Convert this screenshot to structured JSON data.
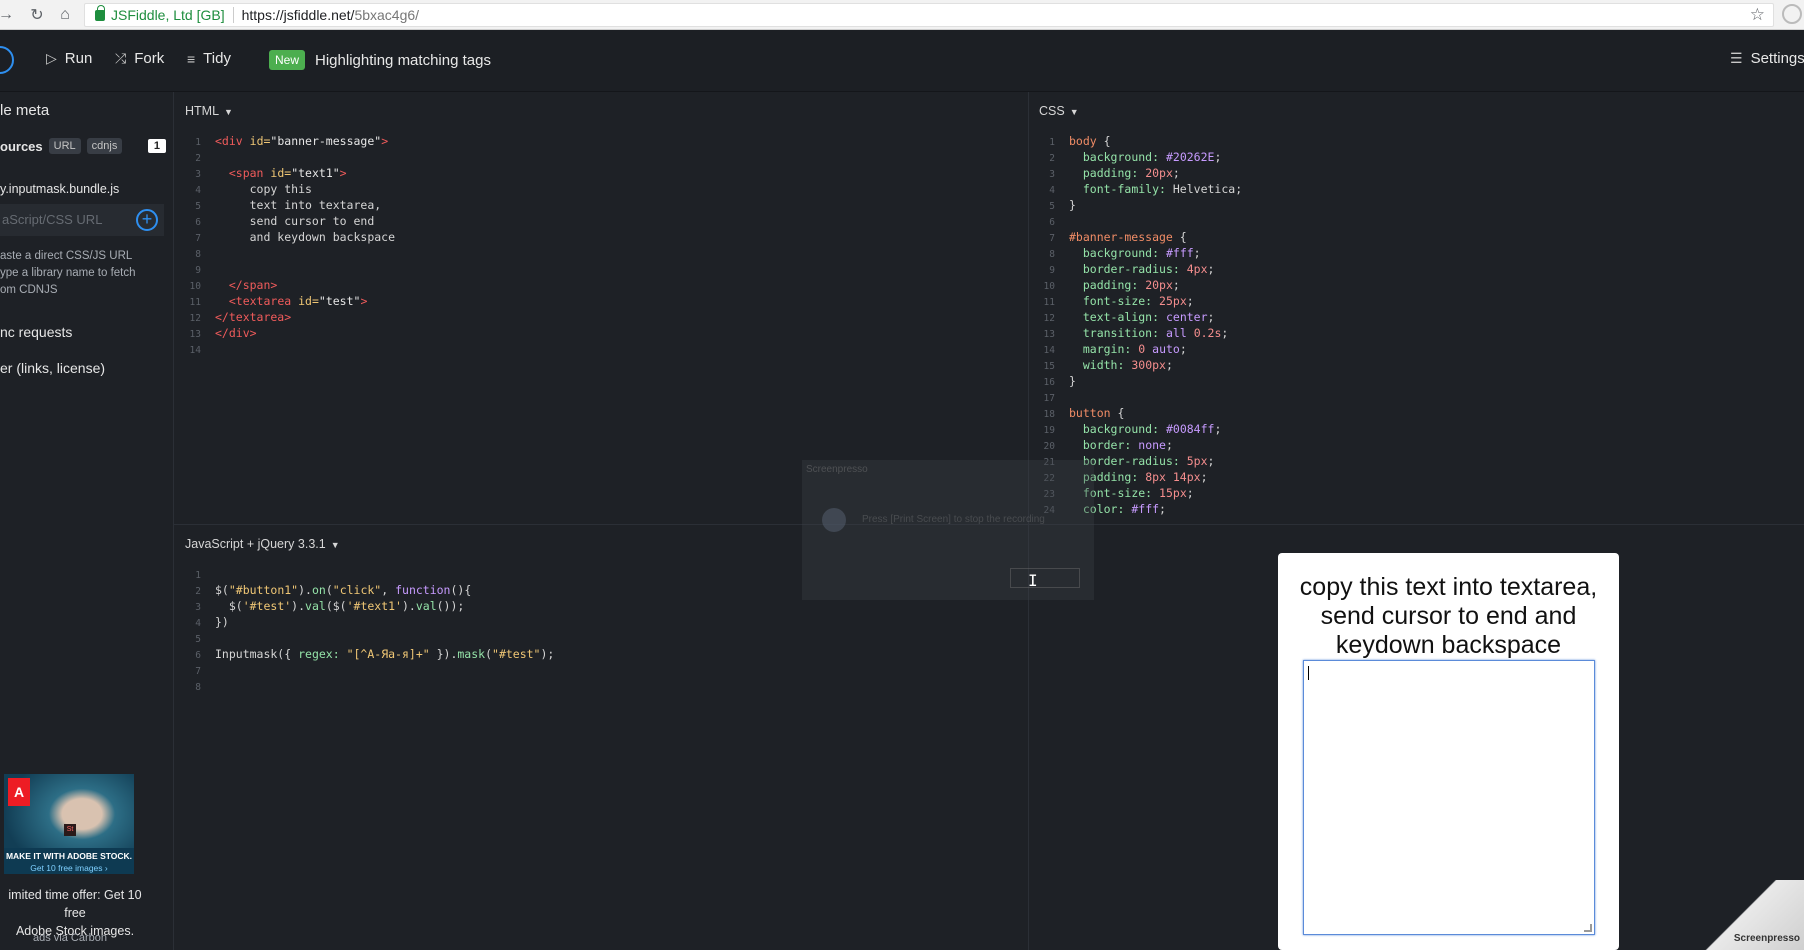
{
  "browser": {
    "site_name": "JSFiddle, Ltd [GB]",
    "url_host": "https://jsfiddle.net/",
    "url_path": "5bxac4g6/"
  },
  "toolbar": {
    "run_label": "Run",
    "fork_label": "Fork",
    "tidy_label": "Tidy",
    "new_badge": "New",
    "feature_label": "Highlighting matching tags",
    "settings_label": "Settings"
  },
  "sidebar": {
    "meta_label": "le meta",
    "resources_label": "ources",
    "url_pill": "URL",
    "cdnjs_pill": "cdnjs",
    "resources_count": "1",
    "file": "y.inputmask.bundle.js",
    "url_placeholder": "aScript/CSS URL",
    "hint_lines": [
      "aste a direct CSS/JS URL",
      "ype a library name to fetch",
      "om CDNJS"
    ],
    "async_label": "nc requests",
    "other_label": "er (links, license)",
    "ad_logo": "A",
    "ad_badge": "St",
    "ad_strip_title": "MAKE IT WITH ADOBE STOCK.",
    "ad_strip_sub": "Get 10 free images ›",
    "ad_text_1": "imited time offer: Get 10 free",
    "ad_text_2": "Adobe Stock images.",
    "ad_via": "ads via Carbon"
  },
  "panels": {
    "html_title": "HTML",
    "css_title": "CSS",
    "js_title": "JavaScript + jQuery 3.3.1"
  },
  "result": {
    "banner_text": "copy this text into textarea, send cursor to end and keydown backspace"
  },
  "overlay": {
    "title": "Screenpresso",
    "hint": "Press [Print Screen] to stop the recording"
  },
  "watermark": "Screenpresso"
}
